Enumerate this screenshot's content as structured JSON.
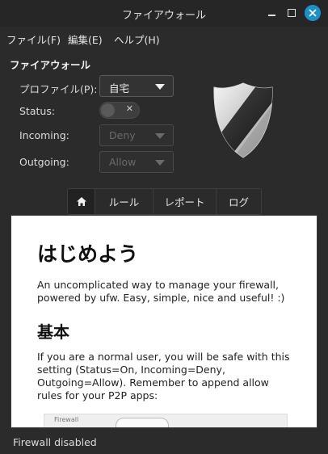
{
  "window": {
    "title": "ファイアウォール"
  },
  "menubar": {
    "items": [
      "ファイル(F)",
      "編集(E)",
      "ヘルプ(H)"
    ]
  },
  "firewall": {
    "section_title": "ファイアウォール",
    "profile_label": "プロファイル(P):",
    "profile_value": "自宅",
    "status_label": "Status:",
    "status_on": false,
    "incoming_label": "Incoming:",
    "incoming_value": "Deny",
    "outgoing_label": "Outgoing:",
    "outgoing_value": "Allow"
  },
  "tabs": {
    "home_icon": "home-icon",
    "rules": "ルール",
    "report": "レポート",
    "log": "ログ"
  },
  "content": {
    "heading": "はじめよう",
    "intro": "An uncomplicated way to manage your firewall, powered by ufw. Easy, simple, nice and useful! :)",
    "subheading": "基本",
    "basic": "If you are a normal user, you will be safe with this setting (Status=On, Incoming=Deny, Outgoing=Allow). Remember to append allow rules for your P2P apps:",
    "preview_text": "Firewall"
  },
  "statusbar": {
    "text": "Firewall disabled"
  },
  "colors": {
    "accent": "#1e90c8",
    "window_bg": "#2b2b2b",
    "content_bg": "#ffffff"
  }
}
